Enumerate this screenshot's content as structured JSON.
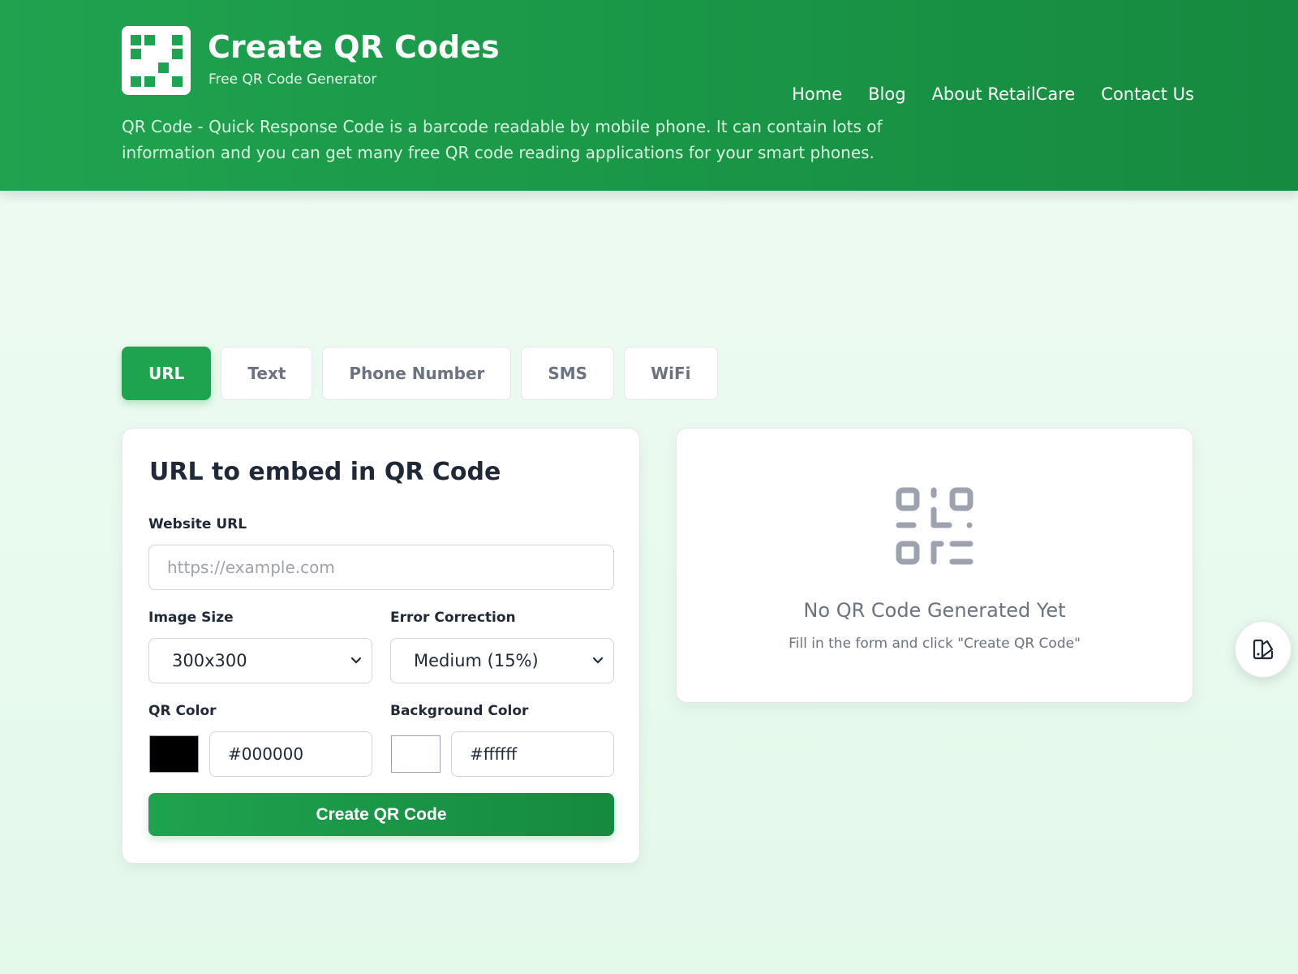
{
  "header": {
    "title": "Create QR Codes",
    "subtitle": "Free QR Code Generator",
    "tagline": "QR Code - Quick Response Code is a barcode readable by mobile phone. It can contain lots of information and you can get many free QR code reading applications for your smart phones.",
    "logo_icon": "qr-logo-icon",
    "nav": [
      {
        "label": "Home"
      },
      {
        "label": "Blog"
      },
      {
        "label": "About RetailCare"
      },
      {
        "label": "Contact Us"
      }
    ]
  },
  "tabs": [
    {
      "label": "URL",
      "active": true
    },
    {
      "label": "Text",
      "active": false
    },
    {
      "label": "Phone Number",
      "active": false
    },
    {
      "label": "SMS",
      "active": false
    },
    {
      "label": "WiFi",
      "active": false
    }
  ],
  "form": {
    "title": "URL to embed in QR Code",
    "url_label": "Website URL",
    "url_placeholder": "https://example.com",
    "url_value": "",
    "size_label": "Image Size",
    "size_value": "300x300",
    "error_label": "Error Correction",
    "error_value": "Medium (15%)",
    "qr_color_label": "QR Color",
    "qr_color_value": "#000000",
    "bg_color_label": "Background Color",
    "bg_color_value": "#ffffff",
    "submit_label": "Create QR Code"
  },
  "preview": {
    "icon": "qr-code-placeholder-icon",
    "empty_title": "No QR Code Generated Yet",
    "empty_subtitle": "Fill in the form and click \"Create QR Code\""
  },
  "floating_button": {
    "icon": "palette-icon"
  },
  "colors": {
    "primary": "#1ea34e",
    "primary_dark": "#168a40",
    "muted_text": "#6b7280"
  }
}
